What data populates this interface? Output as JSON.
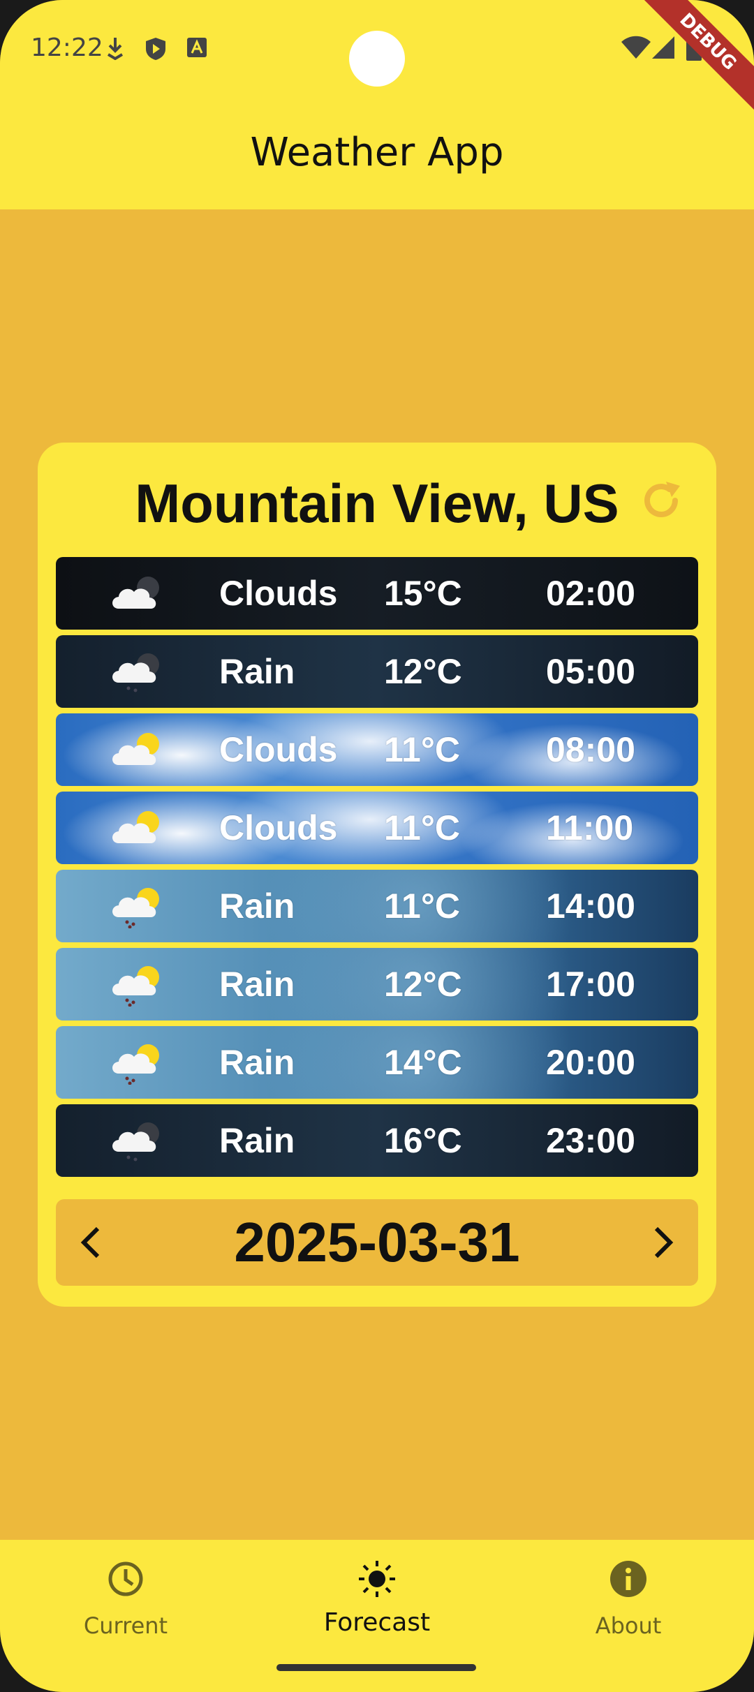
{
  "status_bar": {
    "time": "12:22",
    "debug_label": "DEBUG"
  },
  "app_bar": {
    "title": "Weather App"
  },
  "forecast": {
    "city": "Mountain View, US",
    "rows": [
      {
        "condition": "Clouds",
        "temp": "15°C",
        "time": "02:00",
        "icon": "cloud-night-icon"
      },
      {
        "condition": "Rain",
        "temp": "12°C",
        "time": "05:00",
        "icon": "cloud-night-icon"
      },
      {
        "condition": "Clouds",
        "temp": "11°C",
        "time": "08:00",
        "icon": "cloud-sun-icon"
      },
      {
        "condition": "Clouds",
        "temp": "11°C",
        "time": "11:00",
        "icon": "cloud-sun-icon"
      },
      {
        "condition": "Rain",
        "temp": "11°C",
        "time": "14:00",
        "icon": "rain-sun-icon"
      },
      {
        "condition": "Rain",
        "temp": "12°C",
        "time": "17:00",
        "icon": "rain-sun-icon"
      },
      {
        "condition": "Rain",
        "temp": "14°C",
        "time": "20:00",
        "icon": "rain-sun-icon"
      },
      {
        "condition": "Rain",
        "temp": "16°C",
        "time": "23:00",
        "icon": "rain-night-icon"
      }
    ],
    "date": "2025-03-31"
  },
  "bottom_nav": {
    "items": [
      {
        "label": "Current",
        "icon": "clock-icon"
      },
      {
        "label": "Forecast",
        "icon": "sun-icon"
      },
      {
        "label": "About",
        "icon": "info-icon"
      }
    ],
    "active": "Forecast"
  },
  "colors": {
    "primary_yellow": "#FCE83F",
    "background_amber": "#EDB93C",
    "refresh_icon": "#EDB93C"
  }
}
